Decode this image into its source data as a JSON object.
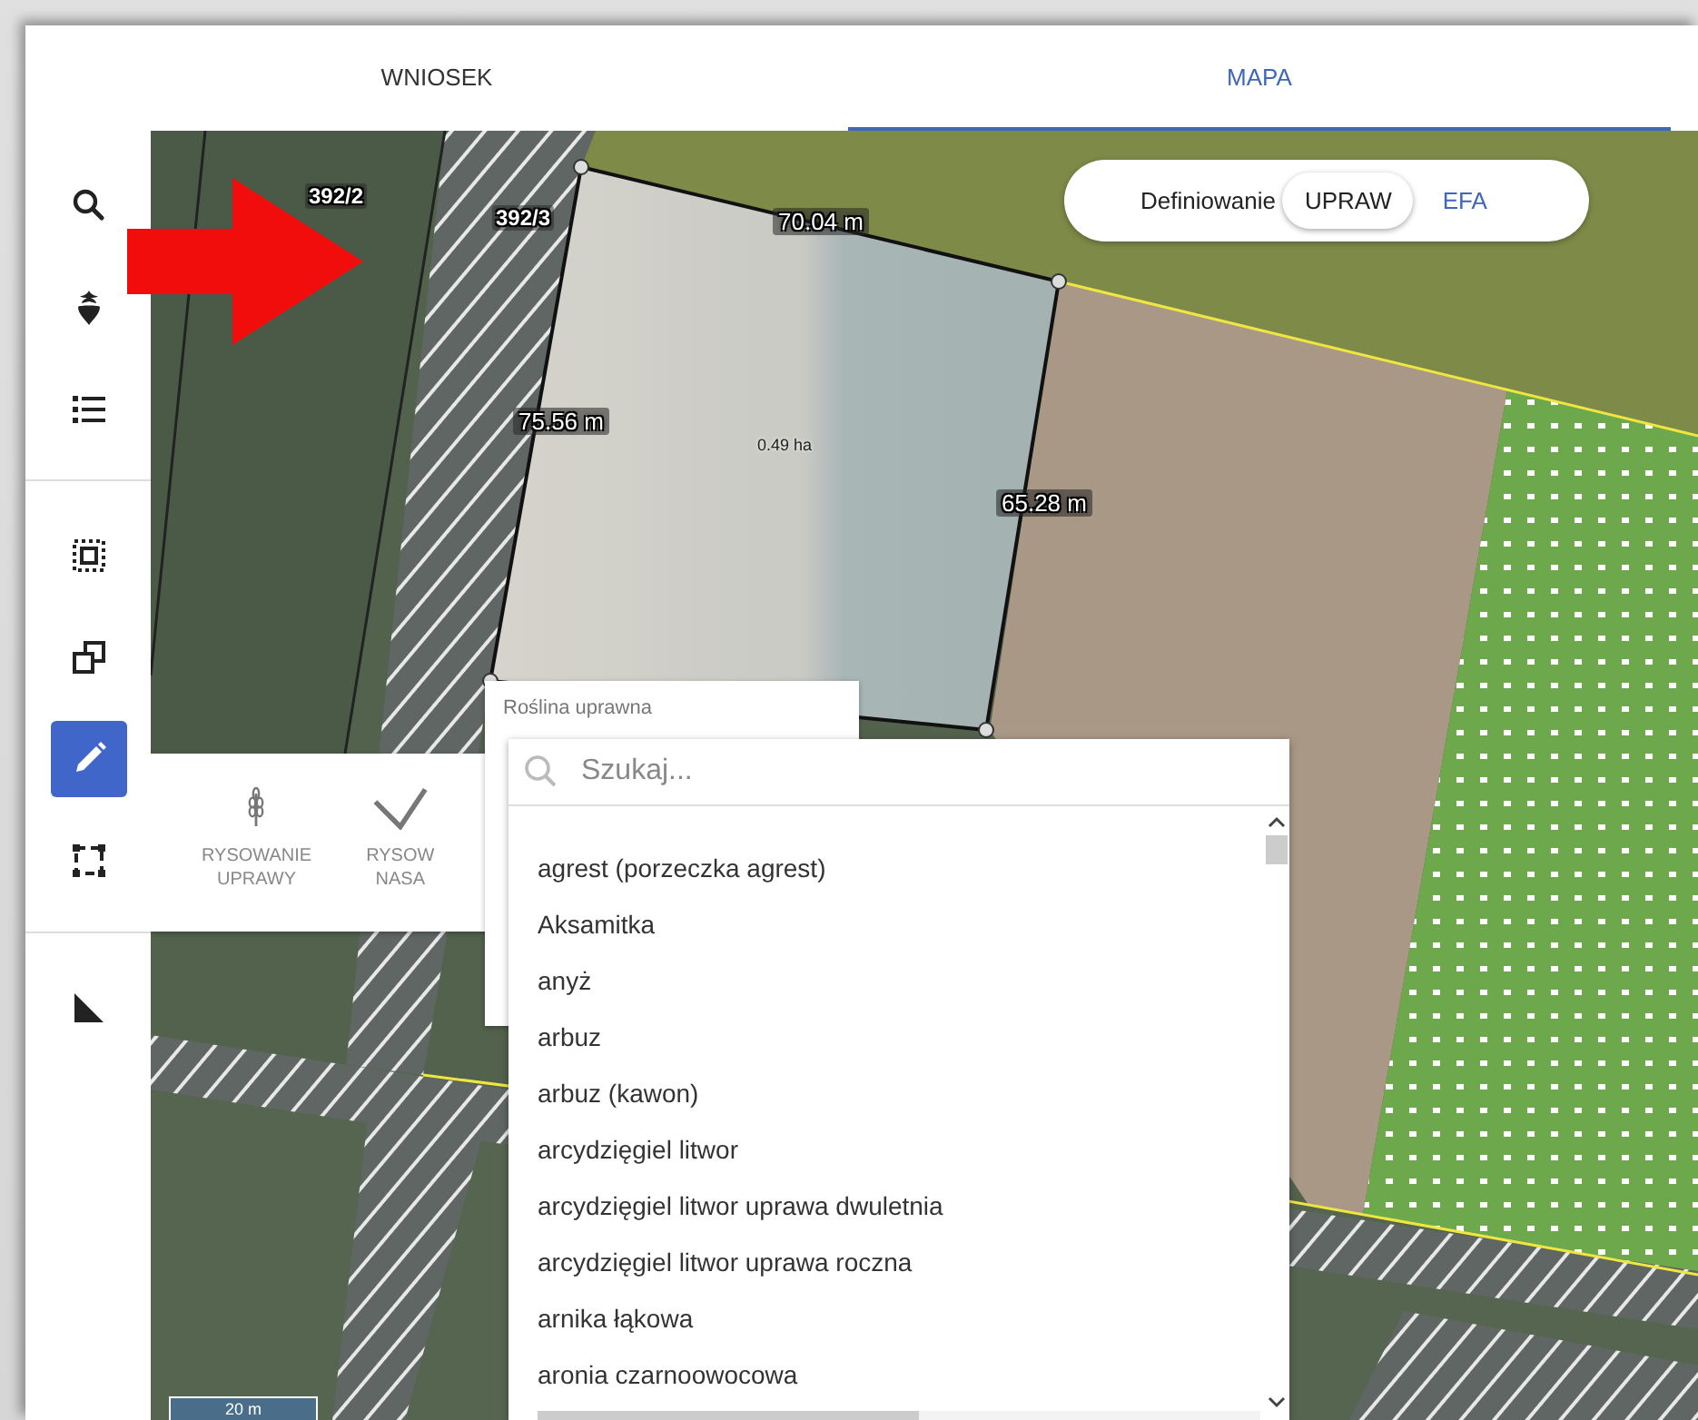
{
  "tabs": [
    {
      "label": "WNIOSEK",
      "selected": false
    },
    {
      "label": "MAPA",
      "selected": true
    }
  ],
  "sidebar": {
    "groups": [
      [
        {
          "kind": "search",
          "selected": false
        },
        {
          "kind": "crop",
          "selected": false
        },
        {
          "kind": "list",
          "selected": false
        }
      ],
      [
        {
          "kind": "select-area",
          "selected": false
        },
        {
          "kind": "copy",
          "selected": false
        },
        {
          "kind": "edit",
          "selected": true
        },
        {
          "kind": "bounding-box",
          "selected": false
        }
      ],
      [
        {
          "kind": "measure",
          "selected": false
        }
      ]
    ]
  },
  "mode_toggle": {
    "label": "Definiowanie",
    "options": [
      {
        "label": "UPRAW",
        "selected": true
      },
      {
        "label": "EFA",
        "selected": false
      }
    ]
  },
  "map": {
    "parcel_labels": [
      "392/2",
      "392/3"
    ],
    "measurements": [
      "70.04 m",
      "75.56 m",
      "65.28 m"
    ],
    "area": "0.49 ha",
    "scale": "20 m"
  },
  "draw_panel": {
    "buttons": [
      {
        "kind": "crop",
        "lines": [
          "RYSOWANIE",
          "UPRAWY"
        ]
      },
      {
        "kind": "planting",
        "lines": [
          "RYSOW",
          "NASA"
        ]
      }
    ]
  },
  "crop_field": {
    "label": "Roślina uprawna"
  },
  "crop_dropdown": {
    "search": {
      "placeholder": "Szukaj..."
    },
    "options": [
      "agrest (porzeczka agrest)",
      "Aksamitka",
      "anyż",
      "arbuz",
      "arbuz (kawon)",
      "arcydzięgiel litwor",
      "arcydzięgiel litwor uprawa dwuletnia",
      "arcydzięgiel litwor uprawa roczna",
      "arnika łąkowa",
      "aronia czarnoowocowa"
    ]
  }
}
